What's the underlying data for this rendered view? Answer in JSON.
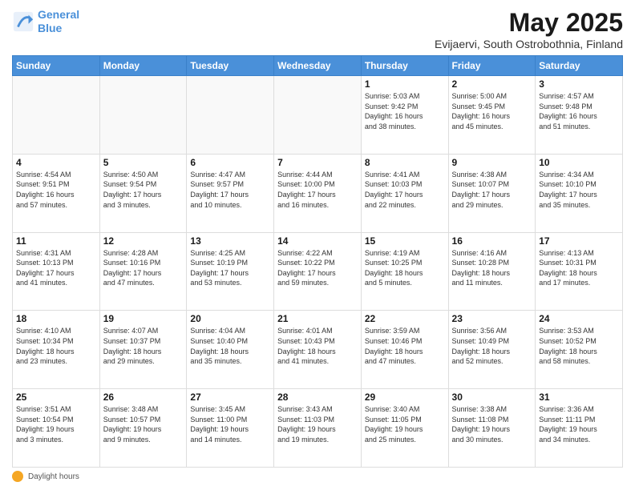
{
  "logo": {
    "line1": "General",
    "line2": "Blue"
  },
  "title": "May 2025",
  "subtitle": "Evijaervi, South Ostrobothnia, Finland",
  "weekdays": [
    "Sunday",
    "Monday",
    "Tuesday",
    "Wednesday",
    "Thursday",
    "Friday",
    "Saturday"
  ],
  "footer_label": "Daylight hours",
  "weeks": [
    [
      {
        "day": "",
        "info": ""
      },
      {
        "day": "",
        "info": ""
      },
      {
        "day": "",
        "info": ""
      },
      {
        "day": "",
        "info": ""
      },
      {
        "day": "1",
        "info": "Sunrise: 5:03 AM\nSunset: 9:42 PM\nDaylight: 16 hours\nand 38 minutes."
      },
      {
        "day": "2",
        "info": "Sunrise: 5:00 AM\nSunset: 9:45 PM\nDaylight: 16 hours\nand 45 minutes."
      },
      {
        "day": "3",
        "info": "Sunrise: 4:57 AM\nSunset: 9:48 PM\nDaylight: 16 hours\nand 51 minutes."
      }
    ],
    [
      {
        "day": "4",
        "info": "Sunrise: 4:54 AM\nSunset: 9:51 PM\nDaylight: 16 hours\nand 57 minutes."
      },
      {
        "day": "5",
        "info": "Sunrise: 4:50 AM\nSunset: 9:54 PM\nDaylight: 17 hours\nand 3 minutes."
      },
      {
        "day": "6",
        "info": "Sunrise: 4:47 AM\nSunset: 9:57 PM\nDaylight: 17 hours\nand 10 minutes."
      },
      {
        "day": "7",
        "info": "Sunrise: 4:44 AM\nSunset: 10:00 PM\nDaylight: 17 hours\nand 16 minutes."
      },
      {
        "day": "8",
        "info": "Sunrise: 4:41 AM\nSunset: 10:03 PM\nDaylight: 17 hours\nand 22 minutes."
      },
      {
        "day": "9",
        "info": "Sunrise: 4:38 AM\nSunset: 10:07 PM\nDaylight: 17 hours\nand 29 minutes."
      },
      {
        "day": "10",
        "info": "Sunrise: 4:34 AM\nSunset: 10:10 PM\nDaylight: 17 hours\nand 35 minutes."
      }
    ],
    [
      {
        "day": "11",
        "info": "Sunrise: 4:31 AM\nSunset: 10:13 PM\nDaylight: 17 hours\nand 41 minutes."
      },
      {
        "day": "12",
        "info": "Sunrise: 4:28 AM\nSunset: 10:16 PM\nDaylight: 17 hours\nand 47 minutes."
      },
      {
        "day": "13",
        "info": "Sunrise: 4:25 AM\nSunset: 10:19 PM\nDaylight: 17 hours\nand 53 minutes."
      },
      {
        "day": "14",
        "info": "Sunrise: 4:22 AM\nSunset: 10:22 PM\nDaylight: 17 hours\nand 59 minutes."
      },
      {
        "day": "15",
        "info": "Sunrise: 4:19 AM\nSunset: 10:25 PM\nDaylight: 18 hours\nand 5 minutes."
      },
      {
        "day": "16",
        "info": "Sunrise: 4:16 AM\nSunset: 10:28 PM\nDaylight: 18 hours\nand 11 minutes."
      },
      {
        "day": "17",
        "info": "Sunrise: 4:13 AM\nSunset: 10:31 PM\nDaylight: 18 hours\nand 17 minutes."
      }
    ],
    [
      {
        "day": "18",
        "info": "Sunrise: 4:10 AM\nSunset: 10:34 PM\nDaylight: 18 hours\nand 23 minutes."
      },
      {
        "day": "19",
        "info": "Sunrise: 4:07 AM\nSunset: 10:37 PM\nDaylight: 18 hours\nand 29 minutes."
      },
      {
        "day": "20",
        "info": "Sunrise: 4:04 AM\nSunset: 10:40 PM\nDaylight: 18 hours\nand 35 minutes."
      },
      {
        "day": "21",
        "info": "Sunrise: 4:01 AM\nSunset: 10:43 PM\nDaylight: 18 hours\nand 41 minutes."
      },
      {
        "day": "22",
        "info": "Sunrise: 3:59 AM\nSunset: 10:46 PM\nDaylight: 18 hours\nand 47 minutes."
      },
      {
        "day": "23",
        "info": "Sunrise: 3:56 AM\nSunset: 10:49 PM\nDaylight: 18 hours\nand 52 minutes."
      },
      {
        "day": "24",
        "info": "Sunrise: 3:53 AM\nSunset: 10:52 PM\nDaylight: 18 hours\nand 58 minutes."
      }
    ],
    [
      {
        "day": "25",
        "info": "Sunrise: 3:51 AM\nSunset: 10:54 PM\nDaylight: 19 hours\nand 3 minutes."
      },
      {
        "day": "26",
        "info": "Sunrise: 3:48 AM\nSunset: 10:57 PM\nDaylight: 19 hours\nand 9 minutes."
      },
      {
        "day": "27",
        "info": "Sunrise: 3:45 AM\nSunset: 11:00 PM\nDaylight: 19 hours\nand 14 minutes."
      },
      {
        "day": "28",
        "info": "Sunrise: 3:43 AM\nSunset: 11:03 PM\nDaylight: 19 hours\nand 19 minutes."
      },
      {
        "day": "29",
        "info": "Sunrise: 3:40 AM\nSunset: 11:05 PM\nDaylight: 19 hours\nand 25 minutes."
      },
      {
        "day": "30",
        "info": "Sunrise: 3:38 AM\nSunset: 11:08 PM\nDaylight: 19 hours\nand 30 minutes."
      },
      {
        "day": "31",
        "info": "Sunrise: 3:36 AM\nSunset: 11:11 PM\nDaylight: 19 hours\nand 34 minutes."
      }
    ]
  ]
}
